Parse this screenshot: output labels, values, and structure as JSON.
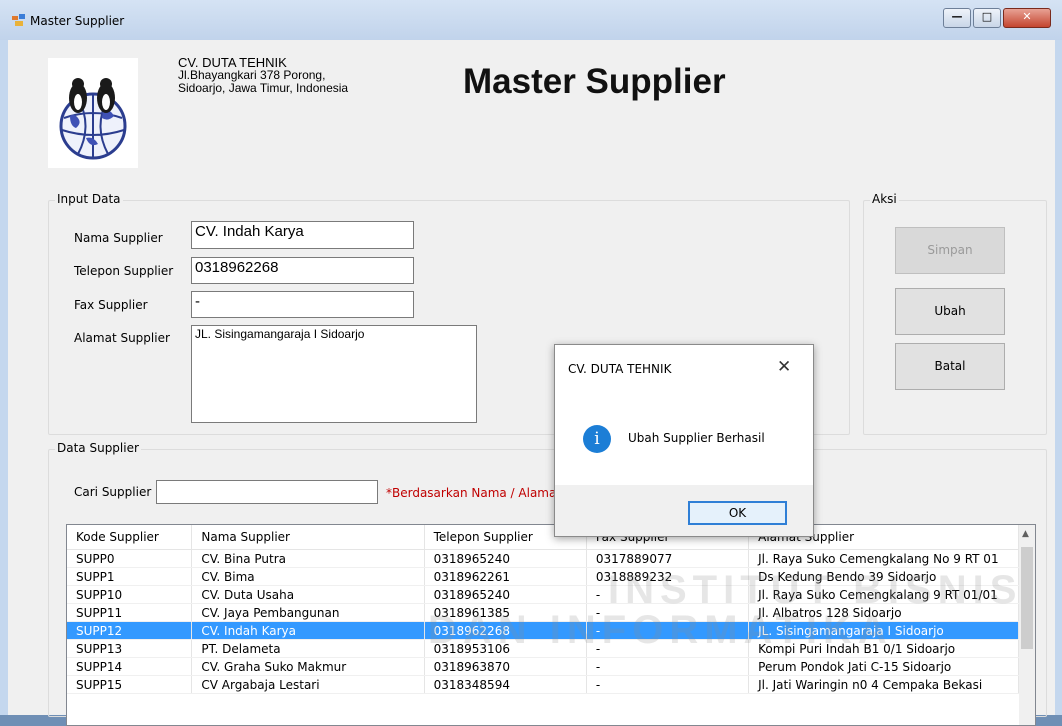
{
  "window": {
    "title": "Master Supplier"
  },
  "company": {
    "name": "CV. DUTA TEHNIK",
    "address1": "Jl.Bhayangkari 378 Porong,",
    "address2": "Sidoarjo, Jawa Timur, Indonesia"
  },
  "page_title": "Master Supplier",
  "input_group": {
    "label": "Input Data",
    "nama_label": "Nama Supplier",
    "nama_value": "CV. Indah Karya",
    "telepon_label": "Telepon Supplier",
    "telepon_value": "0318962268",
    "fax_label": "Fax Supplier",
    "fax_value": "-",
    "alamat_label": "Alamat Supplier",
    "alamat_value": "JL. Sisingamangaraja I Sidoarjo"
  },
  "aksi_group": {
    "label": "Aksi",
    "simpan": "Simpan",
    "ubah": "Ubah",
    "batal": "Batal"
  },
  "data_group": {
    "label": "Data Supplier",
    "cari_label": "Cari Supplier",
    "cari_value": "",
    "hint": "*Berdasarkan Nama / Alama"
  },
  "table": {
    "columns": [
      "Kode Supplier",
      "Nama Supplier",
      "Telepon Supplier",
      "Fax Supplier",
      "Alamat Supplier"
    ],
    "rows": [
      [
        "SUPP0",
        "CV. Bina Putra",
        "0318965240",
        "0317889077",
        "Jl. Raya Suko Cemengkalang No 9 RT 01"
      ],
      [
        "SUPP1",
        "CV. Bima",
        "0318962261",
        "0318889232",
        "Ds Kedung Bendo 39 Sidoarjo"
      ],
      [
        "SUPP10",
        "CV. Duta Usaha",
        "0318965240",
        "-",
        "Jl. Raya Suko Cemengkalang 9 RT 01/01"
      ],
      [
        "SUPP11",
        "CV. Jaya Pembangunan",
        "0318961385",
        "-",
        "Jl. Albatros 128 Sidoarjo"
      ],
      [
        "SUPP12",
        "CV. Indah Karya",
        "0318962268",
        "-",
        "JL. Sisingamangaraja I Sidoarjo"
      ],
      [
        "SUPP13",
        "PT. Delameta",
        "0318953106",
        "-",
        "Kompi Puri Indah B1 0/1 Sidoarjo"
      ],
      [
        "SUPP14",
        "CV. Graha Suko Makmur",
        "0318963870",
        "-",
        "Perum Pondok Jati C-15 Sidoarjo"
      ],
      [
        "SUPP15",
        "CV Argabaja Lestari",
        "0318348594",
        "-",
        "Jl. Jati Waringin n0 4 Cempaka Bekasi"
      ]
    ],
    "selected_row": 4
  },
  "dialog": {
    "title": "CV. DUTA TEHNIK",
    "message": "Ubah Supplier Berhasil",
    "ok": "OK",
    "icon": "info-icon"
  },
  "watermark": {
    "line1": "INSTITUT BISNIS",
    "line2": "DAN INFORMATIKA"
  },
  "colors": {
    "selection": "#3399ff",
    "hint": "#c00000",
    "dialog_icon": "#1c7ed6"
  }
}
